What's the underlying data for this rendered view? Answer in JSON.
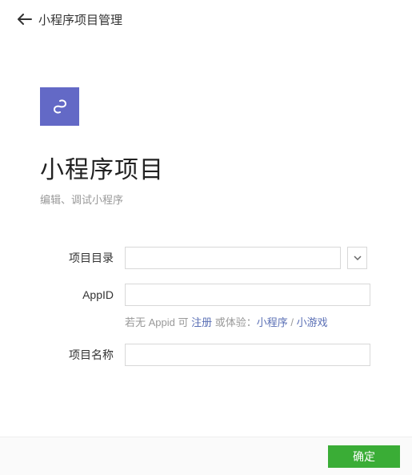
{
  "header": {
    "title": "小程序项目管理"
  },
  "logo": {
    "color": "#6369c6"
  },
  "main": {
    "title": "小程序项目",
    "subtitle": "编辑、调试小程序"
  },
  "form": {
    "projectDir": {
      "label": "项目目录",
      "value": ""
    },
    "appId": {
      "label": "AppID",
      "value": "",
      "hint_prefix": "若无 Appid 可 ",
      "hint_register": "注册",
      "hint_middle": " 或体验：",
      "hint_miniprogram": "小程序",
      "hint_sep": " / ",
      "hint_minigame": "小游戏"
    },
    "projectName": {
      "label": "项目名称",
      "value": ""
    }
  },
  "footer": {
    "confirm": "确定"
  }
}
